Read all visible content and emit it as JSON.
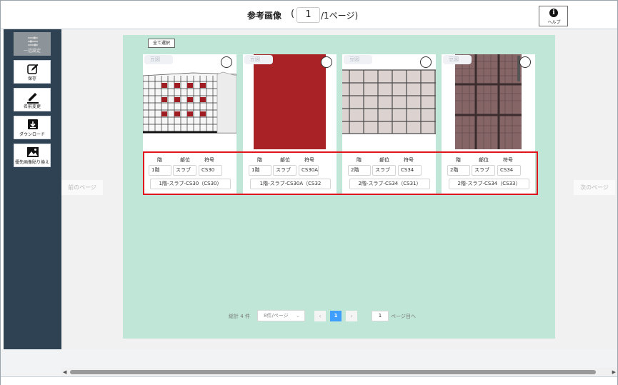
{
  "header": {
    "title": "参考画像",
    "paren": "(",
    "page_value": "1",
    "page_suffix": "/1ページ)",
    "help_label": "ヘルプ"
  },
  "sidebar": {
    "items": [
      {
        "label": "一括設定",
        "icon": "sliders-icon"
      },
      {
        "label": "保存",
        "icon": "edit-icon"
      },
      {
        "label": "名前変更",
        "icon": "pen-icon"
      },
      {
        "label": "ダウンロード",
        "icon": "download-icon"
      },
      {
        "label": "優先画像貼り換え",
        "icon": "image-icon"
      }
    ]
  },
  "nav": {
    "prev": "前のページ",
    "next": "次のページ"
  },
  "select_all": "全て選択",
  "columns": {
    "floor": "階",
    "part": "部位",
    "code": "符号"
  },
  "cards": [
    {
      "tag": "豆図",
      "floor": "1階",
      "part": "スラブ",
      "code": "CS30",
      "full_name": "1階-スラブ-CS30（CS30）"
    },
    {
      "tag": "豆図",
      "floor": "1階",
      "part": "スラブ",
      "code": "CS30A",
      "full_name": "1階-スラブ-CS30A（CS32"
    },
    {
      "tag": "豆図",
      "floor": "2階",
      "part": "スラブ",
      "code": "CS34",
      "full_name": "2階-スラブ-CS34（CS31）"
    },
    {
      "tag": "豆図",
      "floor": "2階",
      "part": "スラブ",
      "code": "CS34",
      "full_name": "2階-スラブ-CS34（CS33）"
    }
  ],
  "pagination": {
    "total": "総計 4 件",
    "page_size": "8件/ページ",
    "prev": "‹",
    "current": "1",
    "next": "›",
    "goto_value": "1",
    "goto_suffix": "ページ目へ"
  },
  "colors": {
    "sidebar": "#2e4254",
    "panel": "#bfe6d6",
    "highlight": "#e0141c",
    "accent": "#409eff",
    "red_image": "#a82226"
  }
}
